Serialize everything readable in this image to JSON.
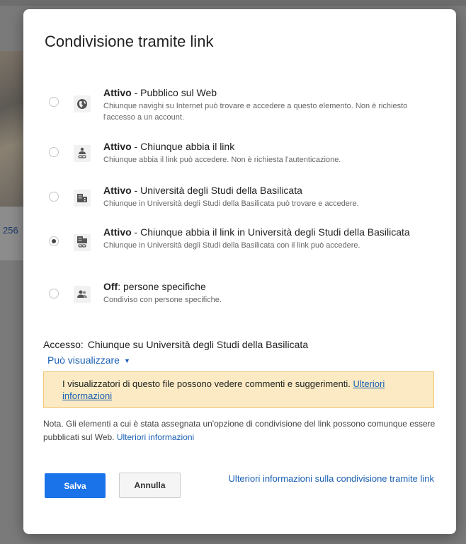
{
  "background": {
    "partial_number": "256"
  },
  "dialog": {
    "title": "Condivisione tramite link",
    "options": [
      {
        "status": "Attivo",
        "label": " - Pubblico sul Web",
        "description": "Chiunque navighi su Internet può trovare e accedere a questo elemento. Non è richiesto l'accesso a un account.",
        "icon": "globe-icon",
        "checked": false
      },
      {
        "status": "Attivo",
        "label": " - Chiunque abbia il link",
        "description": "Chiunque abbia il link può accedere. Non è richiesta l'autenticazione.",
        "icon": "person-link-icon",
        "checked": false
      },
      {
        "status": "Attivo",
        "label": " - Università degli Studi della Basilicata",
        "description": "Chiunque in Università degli Studi della Basilicata può trovare e accedere.",
        "icon": "building-icon",
        "checked": false
      },
      {
        "status": "Attivo",
        "label": " - Chiunque abbia il link in Università degli Studi della Basilicata",
        "description": "Chiunque in Università degli Studi della Basilicata con il link può accedere.",
        "icon": "building-link-icon",
        "checked": true
      },
      {
        "status": "Off",
        "label": ": persone specifiche",
        "description": "Condiviso con persone specifiche.",
        "icon": "people-icon",
        "checked": false
      }
    ],
    "access": {
      "label": "Accesso:",
      "value": "Chiunque su Università degli Studi della Basilicata",
      "permission": "Può visualizzare"
    },
    "notice": {
      "text": "I visualizzatori di questo file possono vedere commenti e suggerimenti.",
      "link": "Ulteriori informazioni"
    },
    "note": {
      "text": "Nota. Gli elementi a cui è stata assegnata un'opzione di condivisione del link possono comunque essere pubblicati sul Web.",
      "link": "Ulteriori informazioni"
    },
    "buttons": {
      "save": "Salva",
      "cancel": "Annulla"
    },
    "more_info_link": "Ulteriori informazioni sulla condivisione tramite link"
  }
}
